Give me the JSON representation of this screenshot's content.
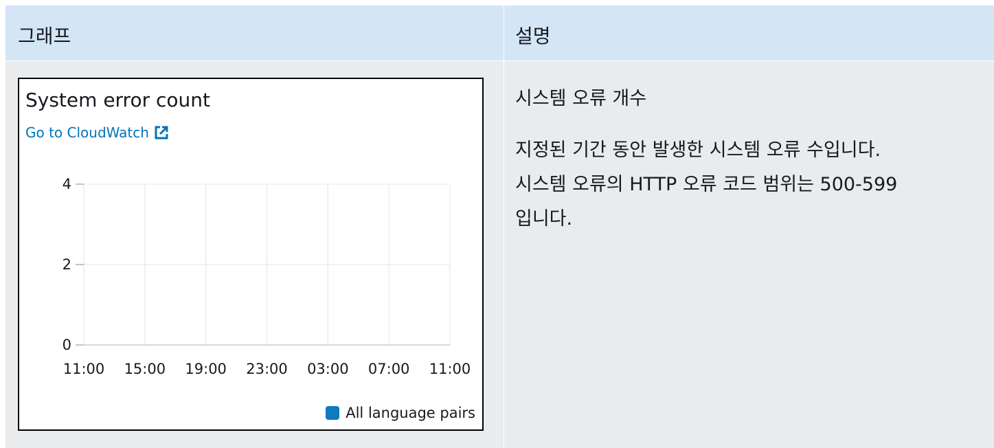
{
  "table": {
    "header": {
      "col_graph": "그래프",
      "col_description": "설명"
    },
    "row": {
      "description_title": "시스템 오류 개수",
      "description_lines": [
        "지정된 기간 동안 발생한 시스템 오류 수입니다.",
        "시스템 오류의 HTTP 오류 코드 범위는 500-599",
        "입니다."
      ]
    }
  },
  "widget": {
    "title": "System error count",
    "link_label": "Go to CloudWatch",
    "link_icon": "external-link-icon",
    "accent_color": "#0073bb"
  },
  "chart_data": {
    "type": "line",
    "title": "System error count",
    "xlabel": "",
    "ylabel": "",
    "x_ticks": [
      "11:00",
      "15:00",
      "19:00",
      "23:00",
      "03:00",
      "07:00",
      "11:00"
    ],
    "y_ticks": [
      0,
      2,
      4
    ],
    "ylim": [
      0,
      4
    ],
    "grid": true,
    "legend_position": "bottom-right",
    "series": [
      {
        "name": "All language pairs",
        "color": "#0f7ac0",
        "values": []
      }
    ]
  }
}
